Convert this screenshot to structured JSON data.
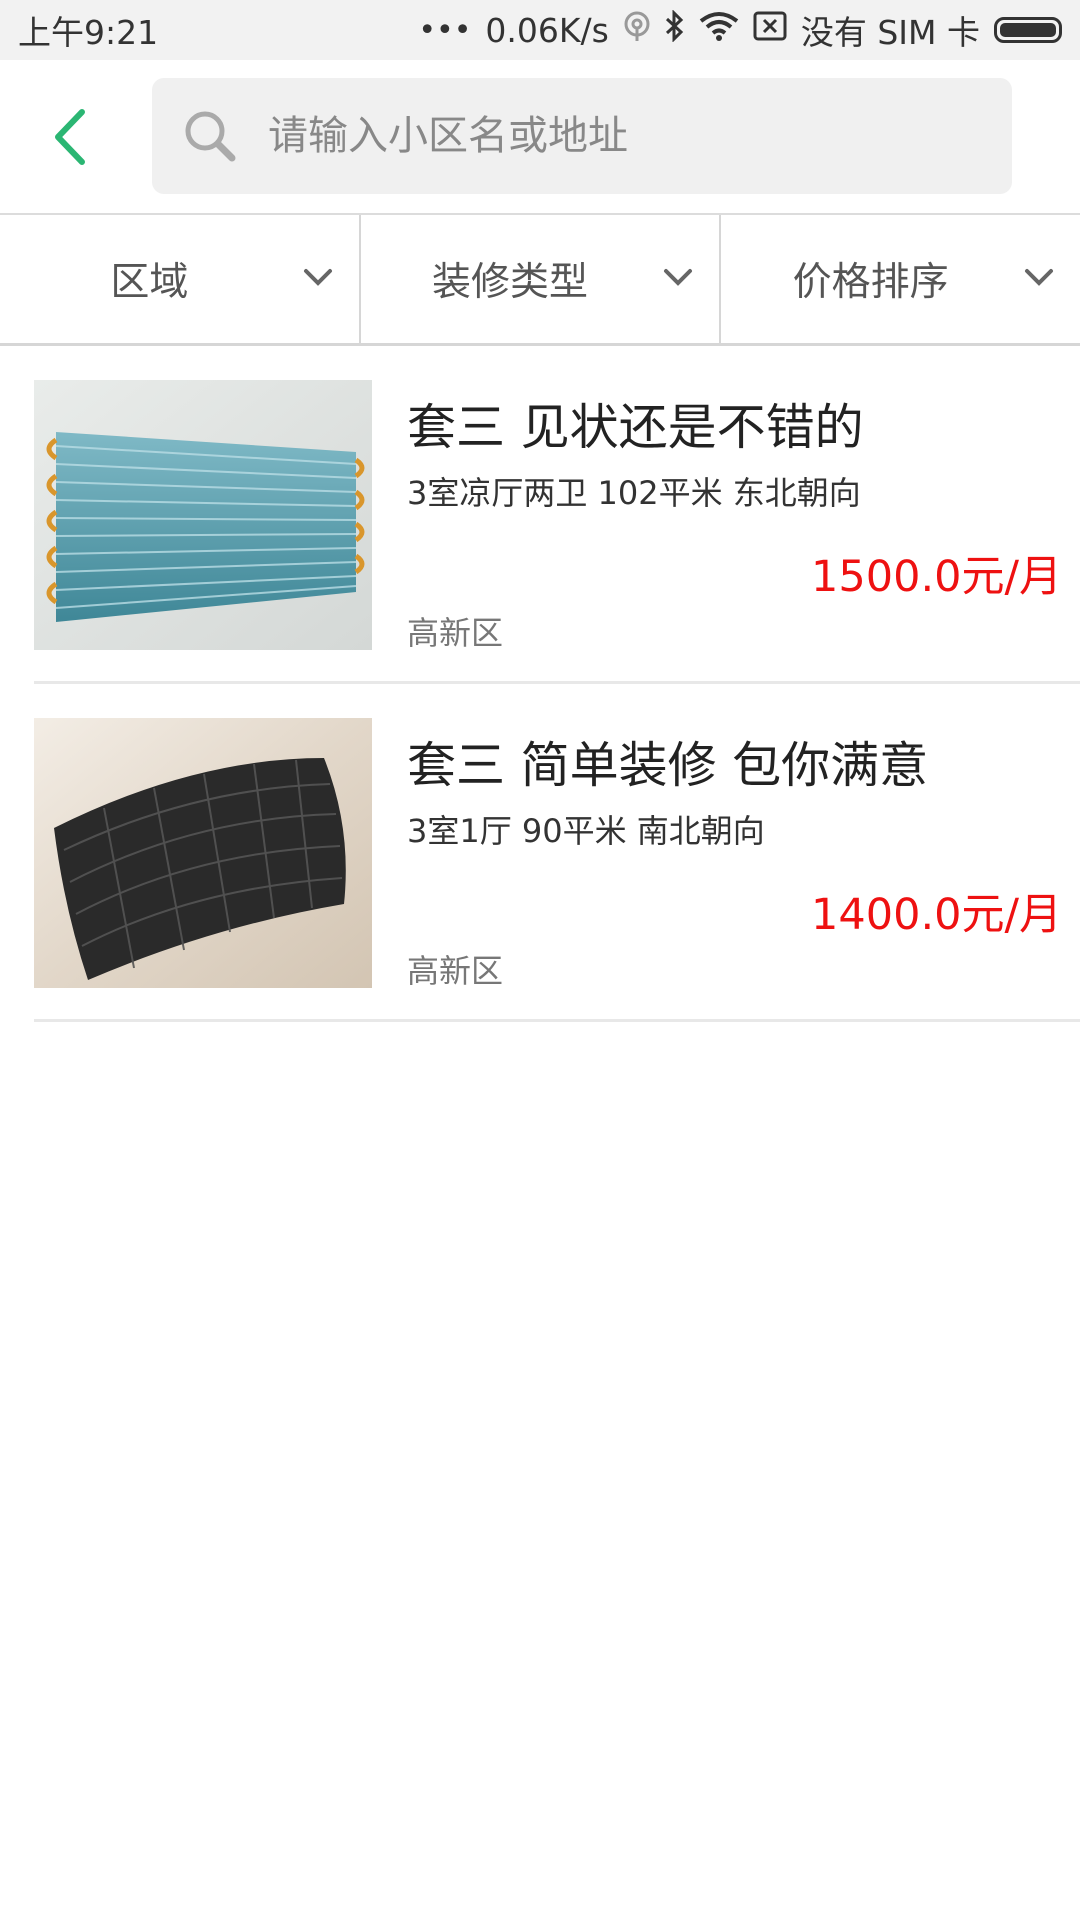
{
  "status_bar": {
    "time": "上午9:21",
    "network_speed": "0.06K/s",
    "carrier": "没有 SIM 卡",
    "icons": [
      "dots-icon",
      "hotspot-icon",
      "bluetooth-icon",
      "wifi-icon",
      "sim-blocked-icon",
      "battery-icon"
    ]
  },
  "header": {
    "back_icon": "chevron-left-icon",
    "accent_color": "#2bb673",
    "search": {
      "placeholder": "请输入小区名或地址",
      "value": ""
    }
  },
  "filters": [
    {
      "label": "区域"
    },
    {
      "label": "装修类型"
    },
    {
      "label": "价格排序"
    }
  ],
  "listings": [
    {
      "title": "套三  见状还是不错的",
      "meta": "3室凉厅两卫  102平米  东北朝向",
      "price": "1500.0元/月",
      "district": "高新区",
      "image": "radiator-coil-photo"
    },
    {
      "title": "套三 简单装修 包你满意",
      "meta": "3室1厅  90平米  南北朝向",
      "price": "1400.0元/月",
      "district": "高新区",
      "image": "filter-mesh-photo"
    }
  ],
  "colors": {
    "price": "#ee1111",
    "accent": "#2bb673",
    "search_bg": "#f0f0f0"
  }
}
